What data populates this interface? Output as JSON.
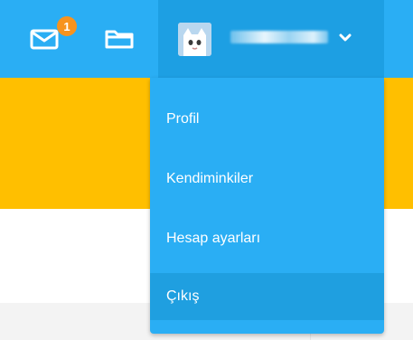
{
  "topbar": {
    "mail_icon": "envelope-icon",
    "notification_count": "1",
    "folder_icon": "folder-icon",
    "user": {
      "avatar_icon": "cat-avatar-icon",
      "username_redacted": true,
      "chevron_icon": "chevron-down-icon"
    }
  },
  "dropdown": {
    "items": [
      {
        "label": "Profil"
      },
      {
        "label": "Kendiminkiler"
      },
      {
        "label": "Hesap ayarları"
      },
      {
        "label": "Çıkış",
        "hovered": true
      }
    ]
  },
  "colors": {
    "header_blue": "#2aaef4",
    "user_trigger_blue": "#1d9fe3",
    "hover_blue": "#1f9fe0",
    "banner_yellow": "#ffbf00",
    "badge_orange": "#f7931e",
    "footer_gray": "#f3f3f3"
  }
}
